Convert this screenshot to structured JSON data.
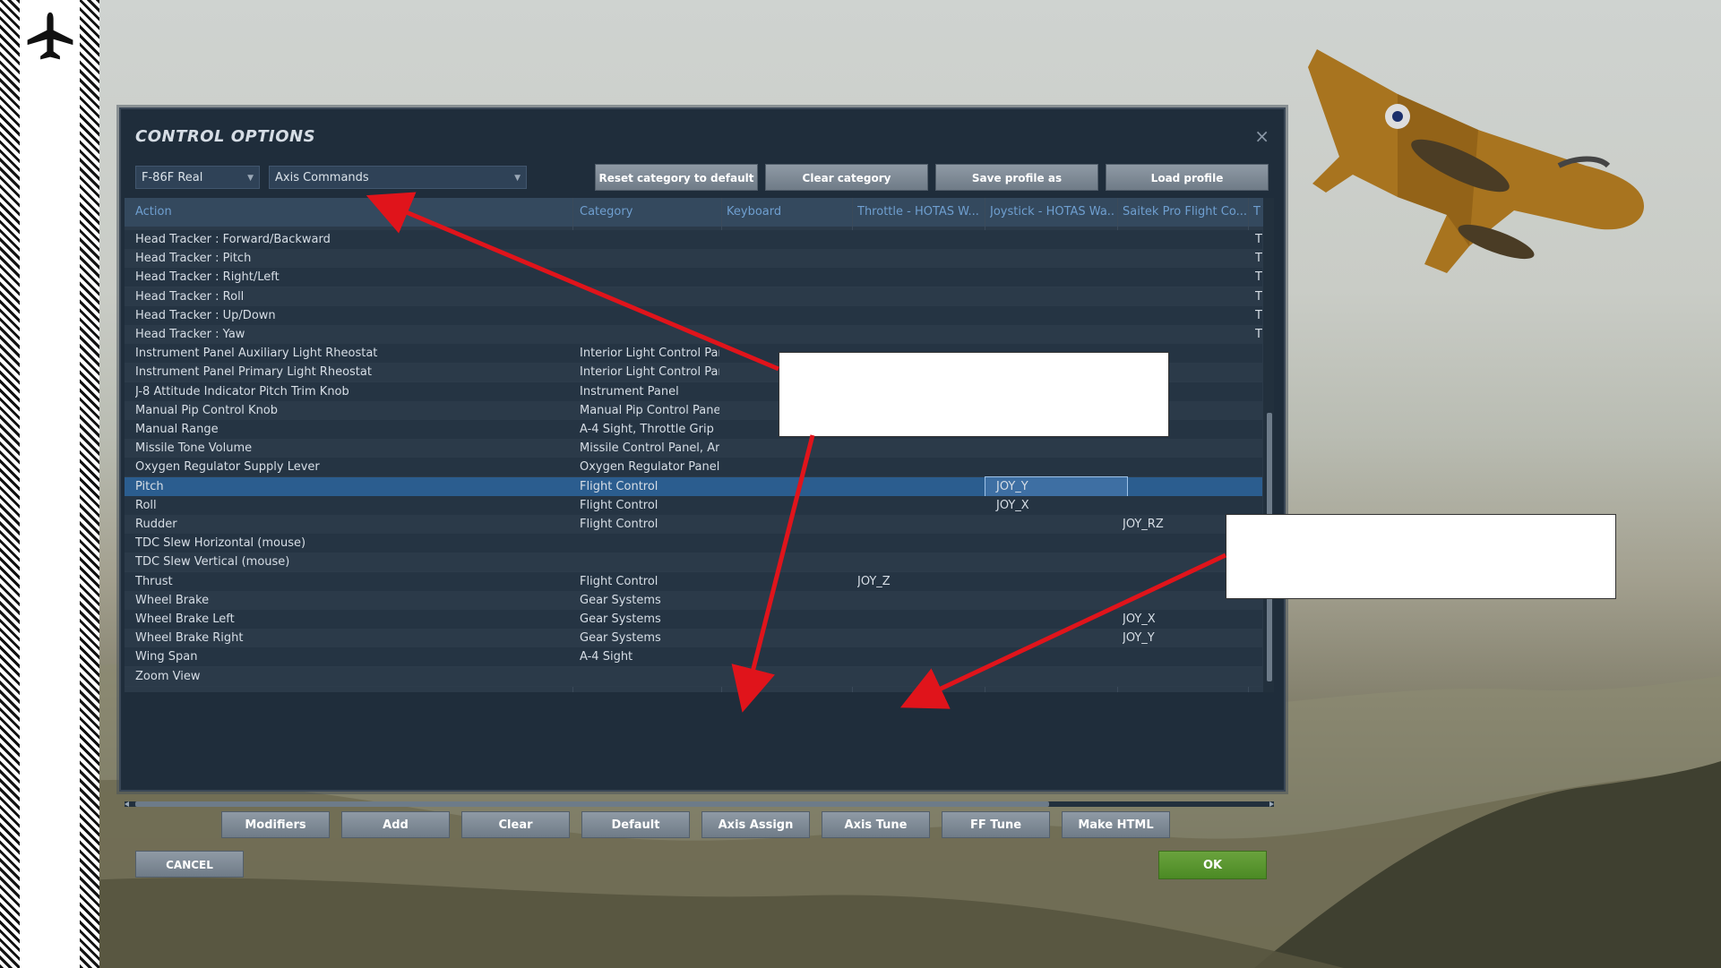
{
  "dialog": {
    "title": "CONTROL OPTIONS",
    "close_glyph": "×"
  },
  "selectors": {
    "aircraft": "F-86F Real",
    "category": "Axis Commands"
  },
  "top_buttons": {
    "reset": "Reset category to default",
    "clear_category": "Clear category",
    "save_profile": "Save profile as",
    "load_profile": "Load profile"
  },
  "columns": [
    "Action",
    "Category",
    "Keyboard",
    "Throttle - HOTAS W...",
    "Joystick - HOTAS Wa...",
    "Saitek Pro Flight Co...",
    "T"
  ],
  "rows": [
    {
      "action": "Head Tracker : Forward/Backward",
      "category": "",
      "keyboard": "",
      "throttle": "",
      "joystick": "",
      "saitek": "",
      "t": "T"
    },
    {
      "action": "Head Tracker : Pitch",
      "category": "",
      "keyboard": "",
      "throttle": "",
      "joystick": "",
      "saitek": "",
      "t": "T"
    },
    {
      "action": "Head Tracker : Right/Left",
      "category": "",
      "keyboard": "",
      "throttle": "",
      "joystick": "",
      "saitek": "",
      "t": "T"
    },
    {
      "action": "Head Tracker : Roll",
      "category": "",
      "keyboard": "",
      "throttle": "",
      "joystick": "",
      "saitek": "",
      "t": "T"
    },
    {
      "action": "Head Tracker : Up/Down",
      "category": "",
      "keyboard": "",
      "throttle": "",
      "joystick": "",
      "saitek": "",
      "t": "T"
    },
    {
      "action": "Head Tracker : Yaw",
      "category": "",
      "keyboard": "",
      "throttle": "",
      "joystick": "",
      "saitek": "",
      "t": "T"
    },
    {
      "action": "Instrument Panel Auxiliary Light Rheostat",
      "category": "Interior Light Control Pane",
      "keyboard": "",
      "throttle": "",
      "joystick": "",
      "saitek": "",
      "t": ""
    },
    {
      "action": "Instrument Panel Primary Light Rheostat",
      "category": "Interior Light Control Pane",
      "keyboard": "",
      "throttle": "",
      "joystick": "",
      "saitek": "",
      "t": ""
    },
    {
      "action": "J-8 Attitude Indicator Pitch Trim Knob",
      "category": "Instrument Panel",
      "keyboard": "",
      "throttle": "",
      "joystick": "",
      "saitek": "",
      "t": ""
    },
    {
      "action": "Manual Pip Control Knob",
      "category": "Manual Pip Control Panel",
      "keyboard": "",
      "throttle": "",
      "joystick": "",
      "saitek": "",
      "t": ""
    },
    {
      "action": "Manual Range",
      "category": "A-4 Sight, Throttle Grip",
      "keyboard": "",
      "throttle": "",
      "joystick": "",
      "saitek": "",
      "t": ""
    },
    {
      "action": "Missile Tone Volume",
      "category": "Missile Control Panel, Arm",
      "keyboard": "",
      "throttle": "",
      "joystick": "",
      "saitek": "",
      "t": ""
    },
    {
      "action": "Oxygen Regulator Supply Lever",
      "category": "Oxygen Regulator Panel",
      "keyboard": "",
      "throttle": "",
      "joystick": "",
      "saitek": "",
      "t": ""
    },
    {
      "action": "Pitch",
      "category": "Flight Control",
      "keyboard": "",
      "throttle": "",
      "joystick": "JOY_Y",
      "saitek": "",
      "t": ""
    },
    {
      "action": "Roll",
      "category": "Flight Control",
      "keyboard": "",
      "throttle": "",
      "joystick": "JOY_X",
      "saitek": "",
      "t": ""
    },
    {
      "action": "Rudder",
      "category": "Flight Control",
      "keyboard": "",
      "throttle": "",
      "joystick": "",
      "saitek": "JOY_RZ",
      "t": ""
    },
    {
      "action": "TDC Slew Horizontal (mouse)",
      "category": "",
      "keyboard": "",
      "throttle": "",
      "joystick": "",
      "saitek": "",
      "t": ""
    },
    {
      "action": "TDC Slew Vertical (mouse)",
      "category": "",
      "keyboard": "",
      "throttle": "",
      "joystick": "",
      "saitek": "",
      "t": ""
    },
    {
      "action": "Thrust",
      "category": "Flight Control",
      "keyboard": "",
      "throttle": "JOY_Z",
      "joystick": "",
      "saitek": "",
      "t": ""
    },
    {
      "action": "Wheel Brake",
      "category": "Gear Systems",
      "keyboard": "",
      "throttle": "",
      "joystick": "",
      "saitek": "",
      "t": ""
    },
    {
      "action": "Wheel Brake Left",
      "category": "Gear Systems",
      "keyboard": "",
      "throttle": "",
      "joystick": "",
      "saitek": "JOY_X",
      "t": ""
    },
    {
      "action": "Wheel Brake Right",
      "category": "Gear Systems",
      "keyboard": "",
      "throttle": "",
      "joystick": "",
      "saitek": "JOY_Y",
      "t": ""
    },
    {
      "action": "Wing Span",
      "category": "A-4 Sight",
      "keyboard": "",
      "throttle": "",
      "joystick": "",
      "saitek": "",
      "t": ""
    },
    {
      "action": "Zoom View",
      "category": "",
      "keyboard": "",
      "throttle": "",
      "joystick": "",
      "saitek": "",
      "t": ""
    }
  ],
  "selected_row": "Pitch",
  "bottom_buttons": [
    "Modifiers",
    "Add",
    "Clear",
    "Default",
    "Axis Assign",
    "Axis Tune",
    "FF Tune",
    "Make HTML"
  ],
  "footer": {
    "cancel": "CANCEL",
    "ok": "OK"
  },
  "colors": {
    "arrow": "#e0141b",
    "ok_button": "#5a9630",
    "header_text": "#6f9fd0"
  },
  "icons": [
    "airplane-icon",
    "close-icon",
    "dropdown-caret-icon"
  ]
}
